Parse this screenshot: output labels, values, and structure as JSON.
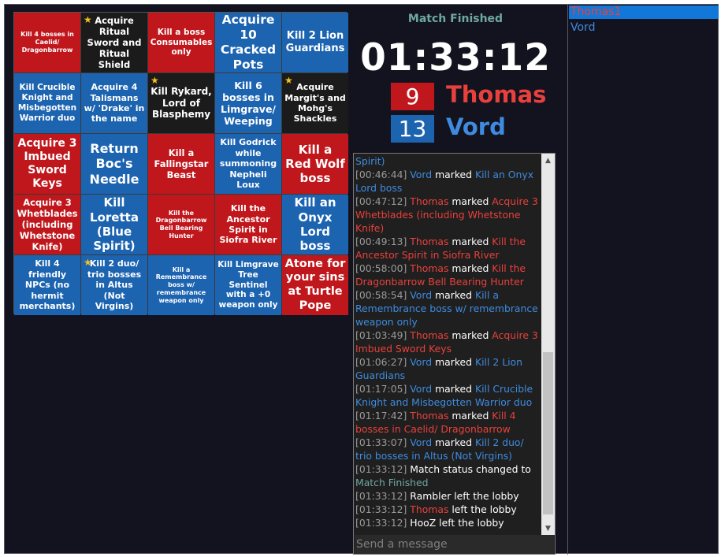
{
  "colors": {
    "red": "#c0171d",
    "blue": "#1c63b0",
    "black": "#1b1b1b",
    "red_text": "#e8413c",
    "blue_text": "#3e8be0",
    "teal": "#6fa8a0",
    "selection": "#1177d8"
  },
  "board": [
    {
      "text": "Kill 4 bosses in Caelid/ Dragonbarrow",
      "color": "red",
      "star": false,
      "size": 8
    },
    {
      "text": "Acquire Ritual Sword and Ritual Shield",
      "color": "black",
      "star": true,
      "size": 11.5
    },
    {
      "text": "Kill a boss Consumables only",
      "color": "red",
      "star": false,
      "size": 10.5
    },
    {
      "text": "Acquire 10 Cracked Pots",
      "color": "blue",
      "star": false,
      "size": 15.5
    },
    {
      "text": "Kill 2 Lion Guardians",
      "color": "blue",
      "star": false,
      "size": 13
    },
    {
      "text": "Kill Crucible Knight and Misbegotten Warrior duo",
      "color": "blue",
      "star": false,
      "size": 10.5
    },
    {
      "text": "Acquire 4 Talismans w/ 'Drake' in the name",
      "color": "blue",
      "star": false,
      "size": 11
    },
    {
      "text": "Kill Rykard, Lord of Blasphemy",
      "color": "black",
      "star": true,
      "size": 12
    },
    {
      "text": "Kill 6 bosses in Limgrave/ Weeping",
      "color": "blue",
      "star": false,
      "size": 12.5
    },
    {
      "text": "Acquire Margit's and Mohg's Shackles",
      "color": "black",
      "star": true,
      "size": 11
    },
    {
      "text": "Acquire 3 Imbued Sword Keys",
      "color": "red",
      "star": false,
      "size": 14
    },
    {
      "text": "Return Boc's Needle",
      "color": "blue",
      "star": false,
      "size": 16
    },
    {
      "text": "Kill a Fallingstar Beast",
      "color": "red",
      "star": false,
      "size": 11.5
    },
    {
      "text": "Kill Godrick while summoning Nepheli Loux",
      "color": "blue",
      "star": false,
      "size": 11
    },
    {
      "text": "Kill a Red Wolf boss",
      "color": "red",
      "star": false,
      "size": 15
    },
    {
      "text": "Acquire 3 Whetblades (including Whetstone Knife)",
      "color": "red",
      "star": false,
      "size": 11.5
    },
    {
      "text": "Kill Loretta (Blue Spirit)",
      "color": "blue",
      "star": false,
      "size": 15
    },
    {
      "text": "Kill the Dragonbarrow Bell Bearing Hunter",
      "color": "red",
      "star": false,
      "size": 8
    },
    {
      "text": "Kill the Ancestor Spirit in Siofra River",
      "color": "red",
      "star": false,
      "size": 11
    },
    {
      "text": "Kill an Onyx Lord boss",
      "color": "blue",
      "star": false,
      "size": 15
    },
    {
      "text": "Kill 4 friendly NPCs (no hermit merchants)",
      "color": "blue",
      "star": false,
      "size": 11
    },
    {
      "text": "Kill 2 duo/ trio bosses in Altus (Not Virgins)",
      "color": "blue",
      "star": true,
      "size": 11
    },
    {
      "text": "Kill a Remembrance boss w/ remembrance weapon only",
      "color": "blue",
      "star": false,
      "size": 8
    },
    {
      "text": "Kill Limgrave Tree Sentinel with a +0 weapon only",
      "color": "blue",
      "star": false,
      "size": 10.5
    },
    {
      "text": "Atone for your sins at Turtle Pope",
      "color": "red",
      "star": false,
      "size": 14.5
    }
  ],
  "match": {
    "status": "Match Finished",
    "timer": "01:33:12",
    "teams": [
      {
        "score": "9",
        "name": "Thomas",
        "color": "red"
      },
      {
        "score": "13",
        "name": "Vord",
        "color": "blue"
      }
    ]
  },
  "chat": {
    "placeholder": "Send a message",
    "scroll_up_icon": "▲",
    "scroll_down_icon": "▼",
    "lines": [
      {
        "time": "",
        "segments": [
          {
            "t": "Spirit)",
            "c": "blue"
          }
        ]
      },
      {
        "time": "[00:46:44]",
        "segments": [
          {
            "t": "Vord",
            "c": "blue"
          },
          {
            "t": " marked ",
            "c": "white"
          },
          {
            "t": "Kill an Onyx Lord boss",
            "c": "blue"
          }
        ]
      },
      {
        "time": "[00:47:12]",
        "segments": [
          {
            "t": "Thomas",
            "c": "red"
          },
          {
            "t": " marked ",
            "c": "white"
          },
          {
            "t": "Acquire 3 Whetblades (including Whetstone Knife)",
            "c": "red"
          }
        ]
      },
      {
        "time": "[00:49:13]",
        "segments": [
          {
            "t": "Thomas",
            "c": "red"
          },
          {
            "t": " marked ",
            "c": "white"
          },
          {
            "t": "Kill the Ancestor Spirit in Siofra River",
            "c": "red"
          }
        ]
      },
      {
        "time": "[00:58:00]",
        "segments": [
          {
            "t": "Thomas",
            "c": "red"
          },
          {
            "t": " marked ",
            "c": "white"
          },
          {
            "t": "Kill the Dragonbarrow Bell Bearing Hunter",
            "c": "red"
          }
        ]
      },
      {
        "time": "[00:58:54]",
        "segments": [
          {
            "t": "Vord",
            "c": "blue"
          },
          {
            "t": " marked ",
            "c": "white"
          },
          {
            "t": "Kill a Remembrance boss w/ remembrance weapon only",
            "c": "blue"
          }
        ]
      },
      {
        "time": "[01:03:49]",
        "segments": [
          {
            "t": "Thomas",
            "c": "red"
          },
          {
            "t": " marked ",
            "c": "white"
          },
          {
            "t": "Acquire 3 Imbued Sword Keys",
            "c": "red"
          }
        ]
      },
      {
        "time": "[01:06:27]",
        "segments": [
          {
            "t": "Vord",
            "c": "blue"
          },
          {
            "t": " marked ",
            "c": "white"
          },
          {
            "t": "Kill 2 Lion Guardians",
            "c": "blue"
          }
        ]
      },
      {
        "time": "[01:17:05]",
        "segments": [
          {
            "t": "Vord",
            "c": "blue"
          },
          {
            "t": " marked ",
            "c": "white"
          },
          {
            "t": "Kill Crucible Knight and Misbegotten Warrior duo",
            "c": "blue"
          }
        ]
      },
      {
        "time": "[01:17:42]",
        "segments": [
          {
            "t": "Thomas",
            "c": "red"
          },
          {
            "t": " marked ",
            "c": "white"
          },
          {
            "t": "Kill 4 bosses in Caelid/ Dragonbarrow",
            "c": "red"
          }
        ]
      },
      {
        "time": "[01:33:07]",
        "segments": [
          {
            "t": "Vord",
            "c": "blue"
          },
          {
            "t": " marked ",
            "c": "white"
          },
          {
            "t": "Kill 2 duo/ trio bosses in Altus (Not Virgins)",
            "c": "blue"
          }
        ]
      },
      {
        "time": "[01:33:12]",
        "segments": [
          {
            "t": "Match status changed to ",
            "c": "white"
          },
          {
            "t": "Match Finished",
            "c": "teal"
          }
        ]
      },
      {
        "time": "[01:33:12]",
        "segments": [
          {
            "t": "Rambler left the lobby",
            "c": "white"
          }
        ]
      },
      {
        "time": "[01:33:12]",
        "segments": [
          {
            "t": "Thomas",
            "c": "red"
          },
          {
            "t": " left the lobby",
            "c": "white"
          }
        ]
      },
      {
        "time": "[01:33:12]",
        "segments": [
          {
            "t": "HooZ left the lobby",
            "c": "white"
          }
        ]
      }
    ]
  },
  "players": [
    {
      "name": "Thomas1",
      "color": "red",
      "selected": true
    },
    {
      "name": "Vord",
      "color": "blue",
      "selected": false
    }
  ]
}
